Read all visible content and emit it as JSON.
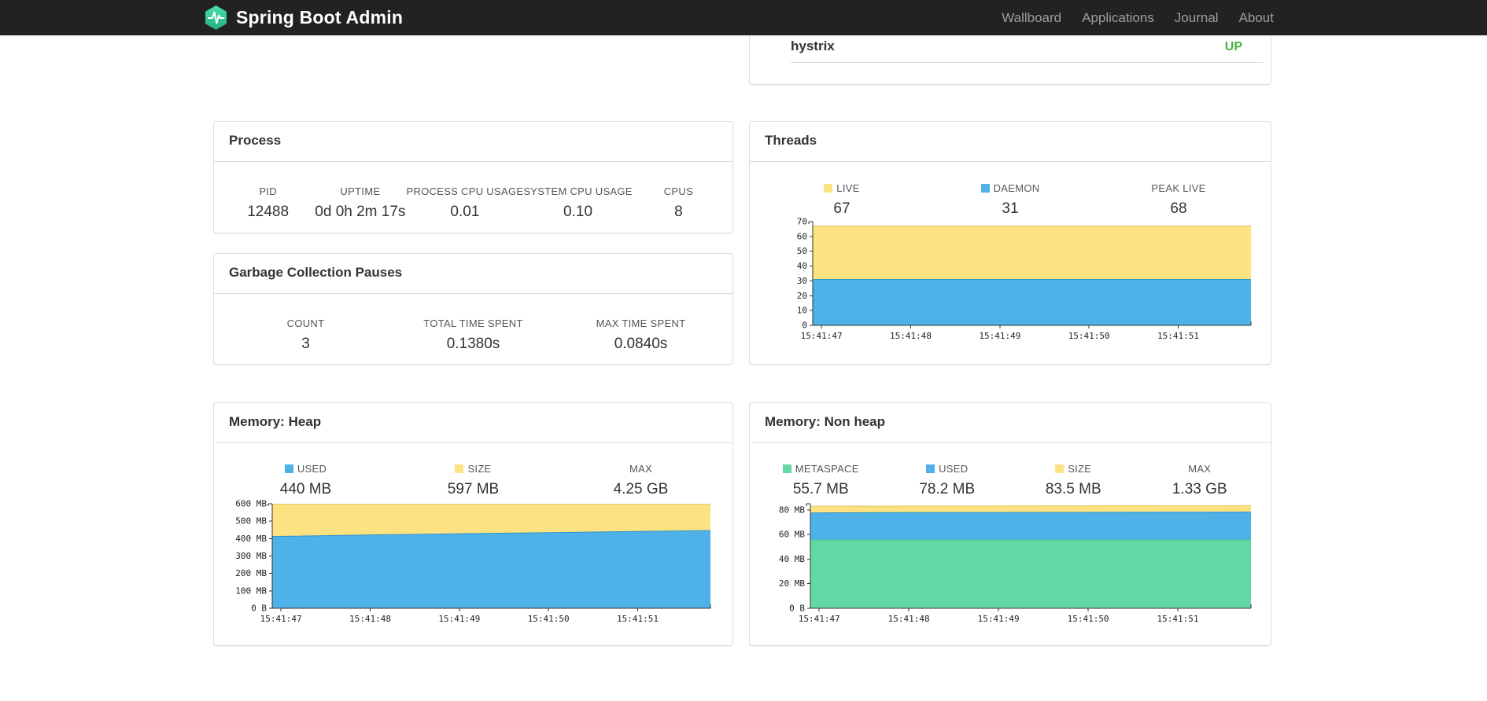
{
  "navbar": {
    "brand": "Spring Boot Admin",
    "items": [
      {
        "label": "Wallboard"
      },
      {
        "label": "Applications"
      },
      {
        "label": "Journal"
      },
      {
        "label": "About"
      }
    ]
  },
  "colors": {
    "blue": "#4eb2e9",
    "yellow": "#fde282",
    "green": "#63d8a5",
    "status_up": "#44b244"
  },
  "application_panel": {
    "name": "hystrix",
    "status": "UP",
    "status_color": "#44b244"
  },
  "panels": {
    "process": {
      "title": "Process",
      "metrics": [
        {
          "label": "PID",
          "value": "12488"
        },
        {
          "label": "UPTIME",
          "value": "0d 0h 2m 17s"
        },
        {
          "label": "PROCESS CPU USAGE",
          "value": "0.01"
        },
        {
          "label": "SYSTEM CPU USAGE",
          "value": "0.10"
        },
        {
          "label": "CPUS",
          "value": "8"
        }
      ]
    },
    "gc": {
      "title": "Garbage Collection Pauses",
      "metrics": [
        {
          "label": "COUNT",
          "value": "3"
        },
        {
          "label": "TOTAL TIME SPENT",
          "value": "0.1380s"
        },
        {
          "label": "MAX TIME SPENT",
          "value": "0.0840s"
        }
      ]
    },
    "threads": {
      "title": "Threads",
      "metrics": [
        {
          "label": "LIVE",
          "value": "67",
          "marker": "#fde282"
        },
        {
          "label": "DAEMON",
          "value": "31",
          "marker": "#4eb2e9"
        },
        {
          "label": "PEAK LIVE",
          "value": "68"
        }
      ]
    },
    "heap": {
      "title": "Memory: Heap",
      "metrics": [
        {
          "label": "USED",
          "value": "440 MB",
          "marker": "#4eb2e9"
        },
        {
          "label": "SIZE",
          "value": "597 MB",
          "marker": "#fde282"
        },
        {
          "label": "MAX",
          "value": "4.25 GB"
        }
      ]
    },
    "nonheap": {
      "title": "Memory: Non heap",
      "metrics": [
        {
          "label": "METASPACE",
          "value": "55.7 MB",
          "marker": "#63d8a5"
        },
        {
          "label": "USED",
          "value": "78.2 MB",
          "marker": "#4eb2e9"
        },
        {
          "label": "SIZE",
          "value": "83.5 MB",
          "marker": "#fde282"
        },
        {
          "label": "MAX",
          "value": "1.33 GB"
        }
      ]
    }
  },
  "chart_data": [
    {
      "type": "area",
      "title": "Threads",
      "xlabel": "",
      "ylabel": "",
      "x": [
        "15:41:47",
        "15:41:48",
        "15:41:49",
        "15:41:50",
        "15:41:51"
      ],
      "ylim": [
        0,
        70
      ],
      "yticks": [
        {
          "v": 0,
          "label": "0"
        },
        {
          "v": 10,
          "label": "10"
        },
        {
          "v": 20,
          "label": "20"
        },
        {
          "v": 30,
          "label": "30"
        },
        {
          "v": 40,
          "label": "40"
        },
        {
          "v": 50,
          "label": "50"
        },
        {
          "v": 60,
          "label": "60"
        },
        {
          "v": 70,
          "label": "70"
        }
      ],
      "legend_position": "top",
      "grid": false,
      "series": [
        {
          "name": "LIVE",
          "color": "#fde282",
          "stroke": "#e8c455",
          "values": [
            67,
            67,
            67,
            67,
            67,
            67
          ]
        },
        {
          "name": "DAEMON",
          "color": "#4eb2e9",
          "stroke": "#2d93cc",
          "values": [
            31,
            31,
            31,
            31,
            31,
            31
          ]
        }
      ]
    },
    {
      "type": "area",
      "title": "Memory: Heap",
      "xlabel": "",
      "ylabel": "",
      "x": [
        "15:41:47",
        "15:41:48",
        "15:41:49",
        "15:41:50",
        "15:41:51"
      ],
      "ylim": [
        0,
        600
      ],
      "yticks": [
        {
          "v": 0,
          "label": "0 B"
        },
        {
          "v": 100,
          "label": "100 MB"
        },
        {
          "v": 200,
          "label": "200 MB"
        },
        {
          "v": 300,
          "label": "300 MB"
        },
        {
          "v": 400,
          "label": "400 MB"
        },
        {
          "v": 500,
          "label": "500 MB"
        },
        {
          "v": 600,
          "label": "600 MB"
        }
      ],
      "legend_position": "top",
      "grid": false,
      "series": [
        {
          "name": "SIZE",
          "color": "#fde282",
          "stroke": "#e8c455",
          "values": [
            597,
            597,
            597,
            597,
            597,
            597
          ]
        },
        {
          "name": "USED",
          "color": "#4eb2e9",
          "stroke": "#2d93cc",
          "values": [
            412,
            420,
            427,
            433,
            440,
            446
          ]
        }
      ]
    },
    {
      "type": "area",
      "title": "Memory: Non heap",
      "xlabel": "",
      "ylabel": "",
      "x": [
        "15:41:47",
        "15:41:48",
        "15:41:49",
        "15:41:50",
        "15:41:51"
      ],
      "ylim": [
        0,
        85
      ],
      "yticks": [
        {
          "v": 0,
          "label": "0 B"
        },
        {
          "v": 20,
          "label": "20 MB"
        },
        {
          "v": 40,
          "label": "40 MB"
        },
        {
          "v": 60,
          "label": "60 MB"
        },
        {
          "v": 80,
          "label": "80 MB"
        }
      ],
      "legend_position": "top",
      "grid": false,
      "series": [
        {
          "name": "SIZE",
          "color": "#fde282",
          "stroke": "#e8c455",
          "values": [
            83.0,
            83.1,
            83.2,
            83.3,
            83.4,
            83.5
          ]
        },
        {
          "name": "USED",
          "color": "#4eb2e9",
          "stroke": "#2d93cc",
          "values": [
            77.6,
            77.8,
            77.9,
            78.0,
            78.1,
            78.2
          ]
        },
        {
          "name": "METASPACE",
          "color": "#63d8a5",
          "stroke": "#3fc48e",
          "values": [
            55.7,
            55.7,
            55.7,
            55.7,
            55.7,
            55.7
          ]
        }
      ]
    }
  ]
}
